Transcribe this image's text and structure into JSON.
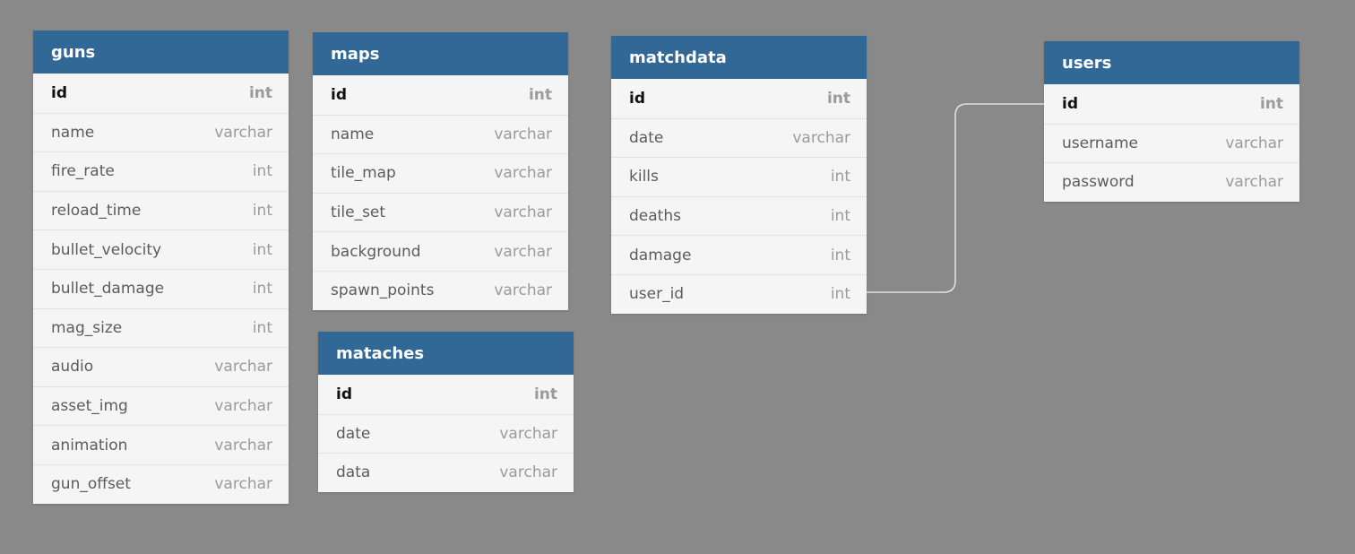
{
  "colors": {
    "canvas_background": "#898989",
    "header_background": "#326896",
    "header_text": "#ffffff",
    "row_background": "#f5f5f5",
    "relation_line": "#e0e0e0"
  },
  "tables": {
    "guns": {
      "name": "guns",
      "fields": [
        {
          "name": "id",
          "type": "int",
          "primary_key": true
        },
        {
          "name": "name",
          "type": "varchar"
        },
        {
          "name": "fire_rate",
          "type": "int"
        },
        {
          "name": "reload_time",
          "type": "int"
        },
        {
          "name": "bullet_velocity",
          "type": "int"
        },
        {
          "name": "bullet_damage",
          "type": "int"
        },
        {
          "name": "mag_size",
          "type": "int"
        },
        {
          "name": "audio",
          "type": "varchar"
        },
        {
          "name": "asset_img",
          "type": "varchar"
        },
        {
          "name": "animation",
          "type": "varchar"
        },
        {
          "name": "gun_offset",
          "type": "varchar"
        }
      ]
    },
    "maps": {
      "name": "maps",
      "fields": [
        {
          "name": "id",
          "type": "int",
          "primary_key": true
        },
        {
          "name": "name",
          "type": "varchar"
        },
        {
          "name": "tile_map",
          "type": "varchar"
        },
        {
          "name": "tile_set",
          "type": "varchar"
        },
        {
          "name": "background",
          "type": "varchar"
        },
        {
          "name": "spawn_points",
          "type": "varchar"
        }
      ]
    },
    "mataches": {
      "name": "mataches",
      "fields": [
        {
          "name": "id",
          "type": "int",
          "primary_key": true
        },
        {
          "name": "date",
          "type": "varchar"
        },
        {
          "name": "data",
          "type": "varchar"
        }
      ]
    },
    "matchdata": {
      "name": "matchdata",
      "fields": [
        {
          "name": "id",
          "type": "int",
          "primary_key": true
        },
        {
          "name": "date",
          "type": "varchar"
        },
        {
          "name": "kills",
          "type": "int"
        },
        {
          "name": "deaths",
          "type": "int"
        },
        {
          "name": "damage",
          "type": "int"
        },
        {
          "name": "user_id",
          "type": "int"
        }
      ]
    },
    "users": {
      "name": "users",
      "fields": [
        {
          "name": "id",
          "type": "int",
          "primary_key": true
        },
        {
          "name": "username",
          "type": "varchar"
        },
        {
          "name": "password",
          "type": "varchar"
        }
      ]
    }
  },
  "relations": [
    {
      "from": "matchdata.user_id",
      "to": "users.id"
    }
  ]
}
